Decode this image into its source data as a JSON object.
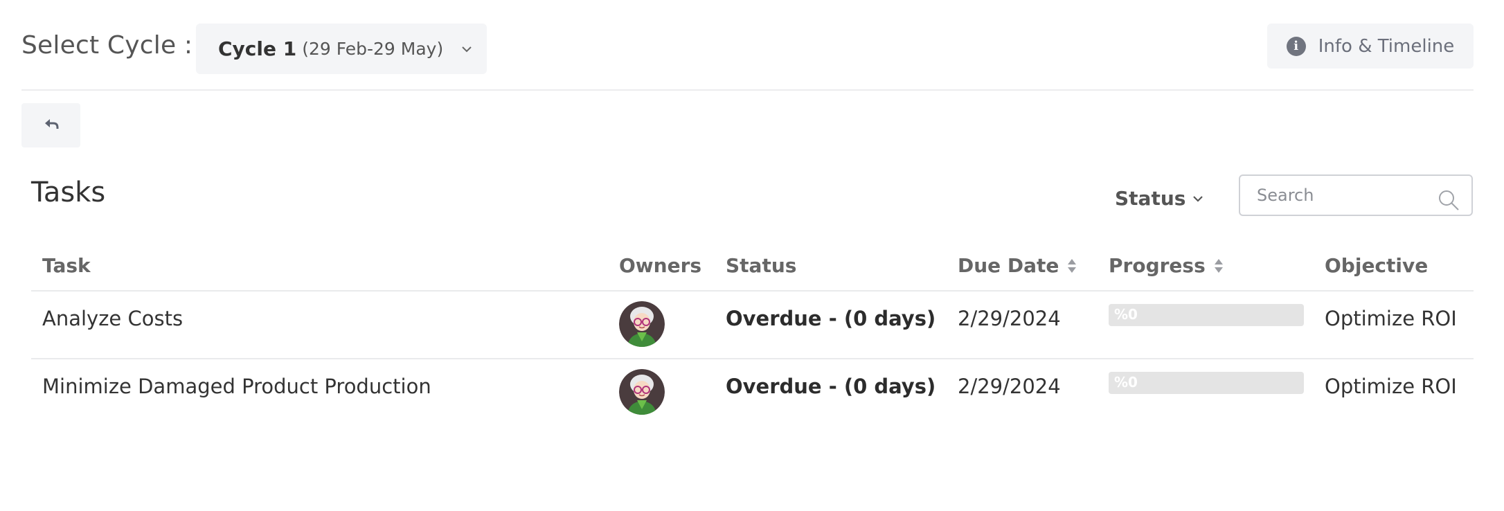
{
  "cycle": {
    "label": "Select Cycle :",
    "selected_name": "Cycle 1",
    "selected_range": "(29 Feb-29 May)"
  },
  "info_button": {
    "label": "Info & Timeline",
    "icon": "info-icon"
  },
  "back_button": {
    "icon": "back-arrow-icon"
  },
  "tasks": {
    "title": "Tasks",
    "status_filter_label": "Status",
    "search": {
      "placeholder": "Search",
      "value": ""
    },
    "columns": {
      "task": "Task",
      "owners": "Owners",
      "status": "Status",
      "due_date": "Due Date",
      "progress": "Progress",
      "objective": "Objective"
    },
    "rows": [
      {
        "task": "Analyze Costs",
        "owner_avatar": "avatar-elderly-woman-glasses",
        "status": "Overdue - (0 days)",
        "due_date": "2/29/2024",
        "progress_text": "%0",
        "progress_value": 0,
        "objective": "Optimize ROI"
      },
      {
        "task": "Minimize Damaged Product Production",
        "owner_avatar": "avatar-elderly-woman-glasses",
        "status": "Overdue - (0 days)",
        "due_date": "2/29/2024",
        "progress_text": "%0",
        "progress_value": 0,
        "objective": "Optimize ROI"
      }
    ]
  },
  "colors": {
    "button_bg": "#f4f5f7",
    "divider": "#ececee",
    "progress_track": "#e4e4e4",
    "text_dark": "#333333",
    "text_muted": "#6b6f7b"
  }
}
